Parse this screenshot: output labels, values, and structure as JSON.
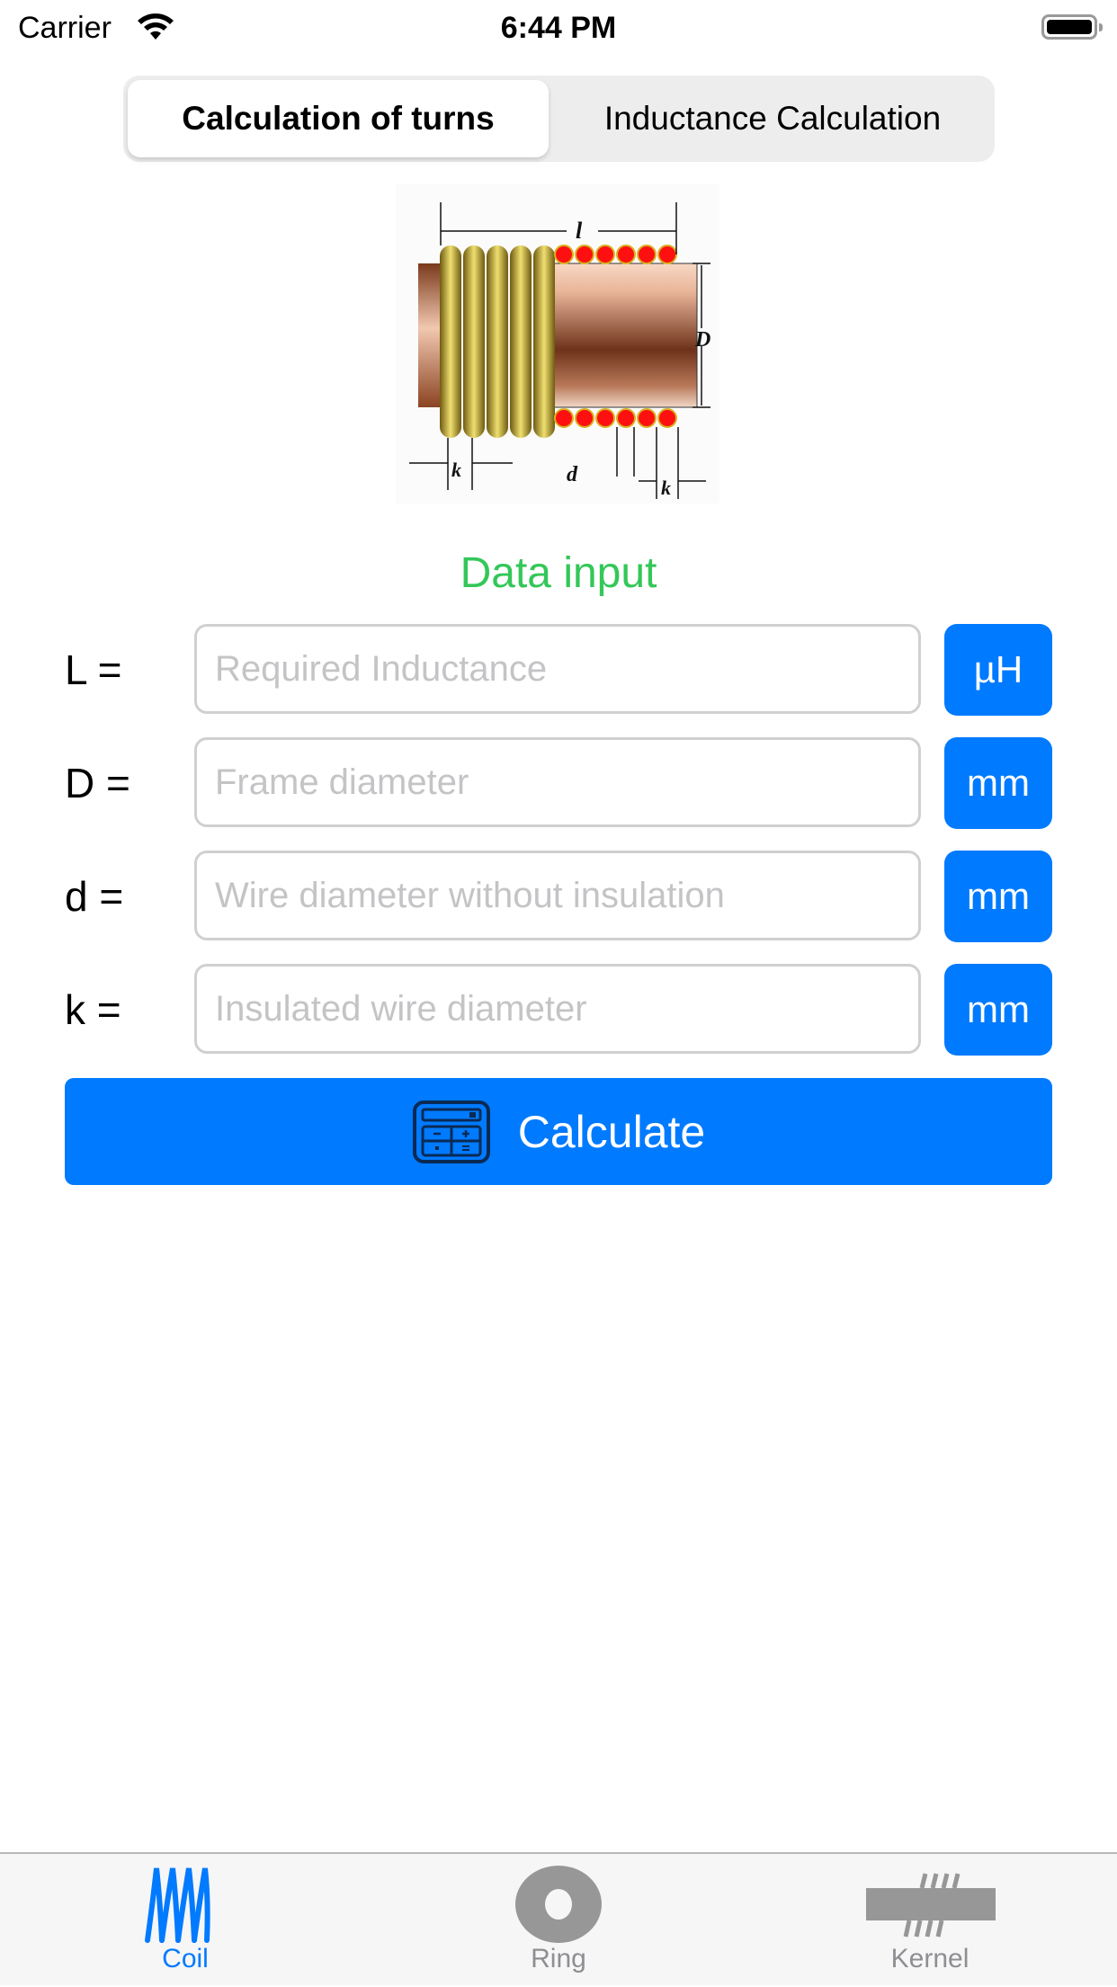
{
  "status_bar": {
    "carrier": "Carrier",
    "time": "6:44 PM",
    "wifi_icon": "wifi-icon",
    "battery_icon": "battery-full-icon"
  },
  "segmented_control": {
    "segments": [
      {
        "label": "Calculation of turns",
        "selected": true
      },
      {
        "label": "Inductance Calculation",
        "selected": false
      }
    ]
  },
  "diagram": {
    "labels": {
      "length": "l",
      "diameter": "D",
      "wire": "d",
      "pitch": "k"
    }
  },
  "form": {
    "title": "Data input",
    "title_color": "#34c759",
    "fields": [
      {
        "label": "L =",
        "placeholder": "Required Inductance",
        "value": "",
        "unit": "µH"
      },
      {
        "label": "D =",
        "placeholder": "Frame diameter",
        "value": "",
        "unit": "mm"
      },
      {
        "label": "d =",
        "placeholder": "Wire diameter without insulation",
        "value": "",
        "unit": "mm"
      },
      {
        "label": "k =",
        "placeholder": "Insulated wire diameter",
        "value": "",
        "unit": "mm"
      }
    ],
    "calculate_label": "Calculate",
    "calculate_icon": "calculator-icon"
  },
  "tab_bar": {
    "accent": "#007aff",
    "inactive_color": "#8e8e93",
    "tabs": [
      {
        "label": "Coil",
        "icon": "coil-icon",
        "active": true
      },
      {
        "label": "Ring",
        "icon": "ring-icon",
        "active": false
      },
      {
        "label": "Kernel",
        "icon": "kernel-icon",
        "active": false
      }
    ]
  }
}
